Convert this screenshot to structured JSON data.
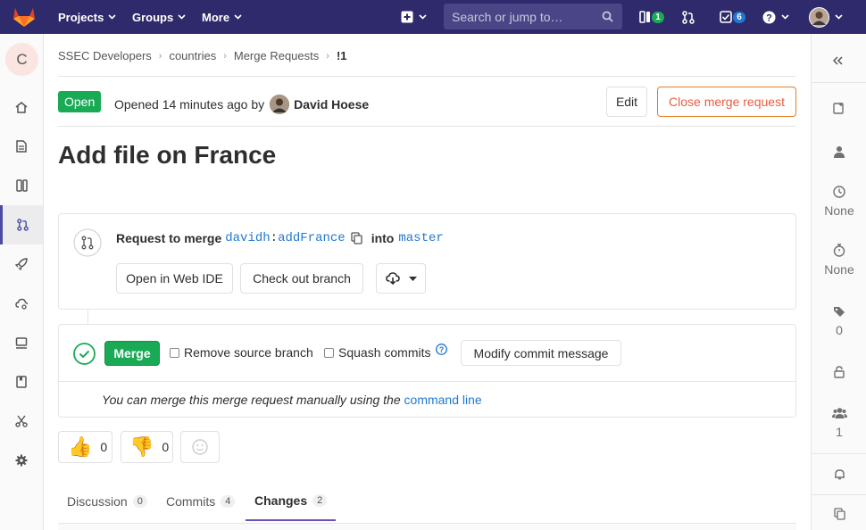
{
  "nav": {
    "projects": "Projects",
    "groups": "Groups",
    "more": "More",
    "search_placeholder": "Search or jump to…",
    "issues_count": "1",
    "todos_count": "6",
    "colors": {
      "bg": "#2f2a6b",
      "green": "#1aaa55",
      "blue": "#1f78d1"
    }
  },
  "sidebar": {
    "project_initial": "C",
    "items": [
      "home-icon",
      "repository-icon",
      "issues-icon",
      "merge-requests-icon",
      "ci-cd-icon",
      "operations-icon",
      "environments-icon",
      "wiki-icon",
      "snippets-icon",
      "settings-icon"
    ]
  },
  "breadcrumb": {
    "items": [
      "SSEC Developers",
      "countries",
      "Merge Requests",
      "!1"
    ]
  },
  "mr": {
    "status": "Open",
    "opened_text": "Opened 14 minutes ago by",
    "author": "David Hoese",
    "edit_label": "Edit",
    "close_label": "Close merge request",
    "title": "Add file on France"
  },
  "widget": {
    "request_text": "Request to merge",
    "source_user": "davidh",
    "source_branch": "addFrance",
    "into_text": "into",
    "target_branch": "master",
    "web_ide_label": "Open in Web IDE",
    "checkout_label": "Check out branch",
    "merge_label": "Merge",
    "remove_source_label": "Remove source branch",
    "squash_label": "Squash commits",
    "modify_commit_label": "Modify commit message",
    "manual_text": "You can merge this merge request manually using the",
    "command_line_label": "command line"
  },
  "reactions": {
    "thumbsup": "0",
    "thumbsdown": "0"
  },
  "tabs": [
    {
      "label": "Discussion",
      "count": "0"
    },
    {
      "label": "Commits",
      "count": "4"
    },
    {
      "label": "Changes",
      "count": "2"
    }
  ],
  "right_sidebar": {
    "milestone": "None",
    "time_tracking": "None",
    "labels": "0",
    "participants": "1"
  }
}
